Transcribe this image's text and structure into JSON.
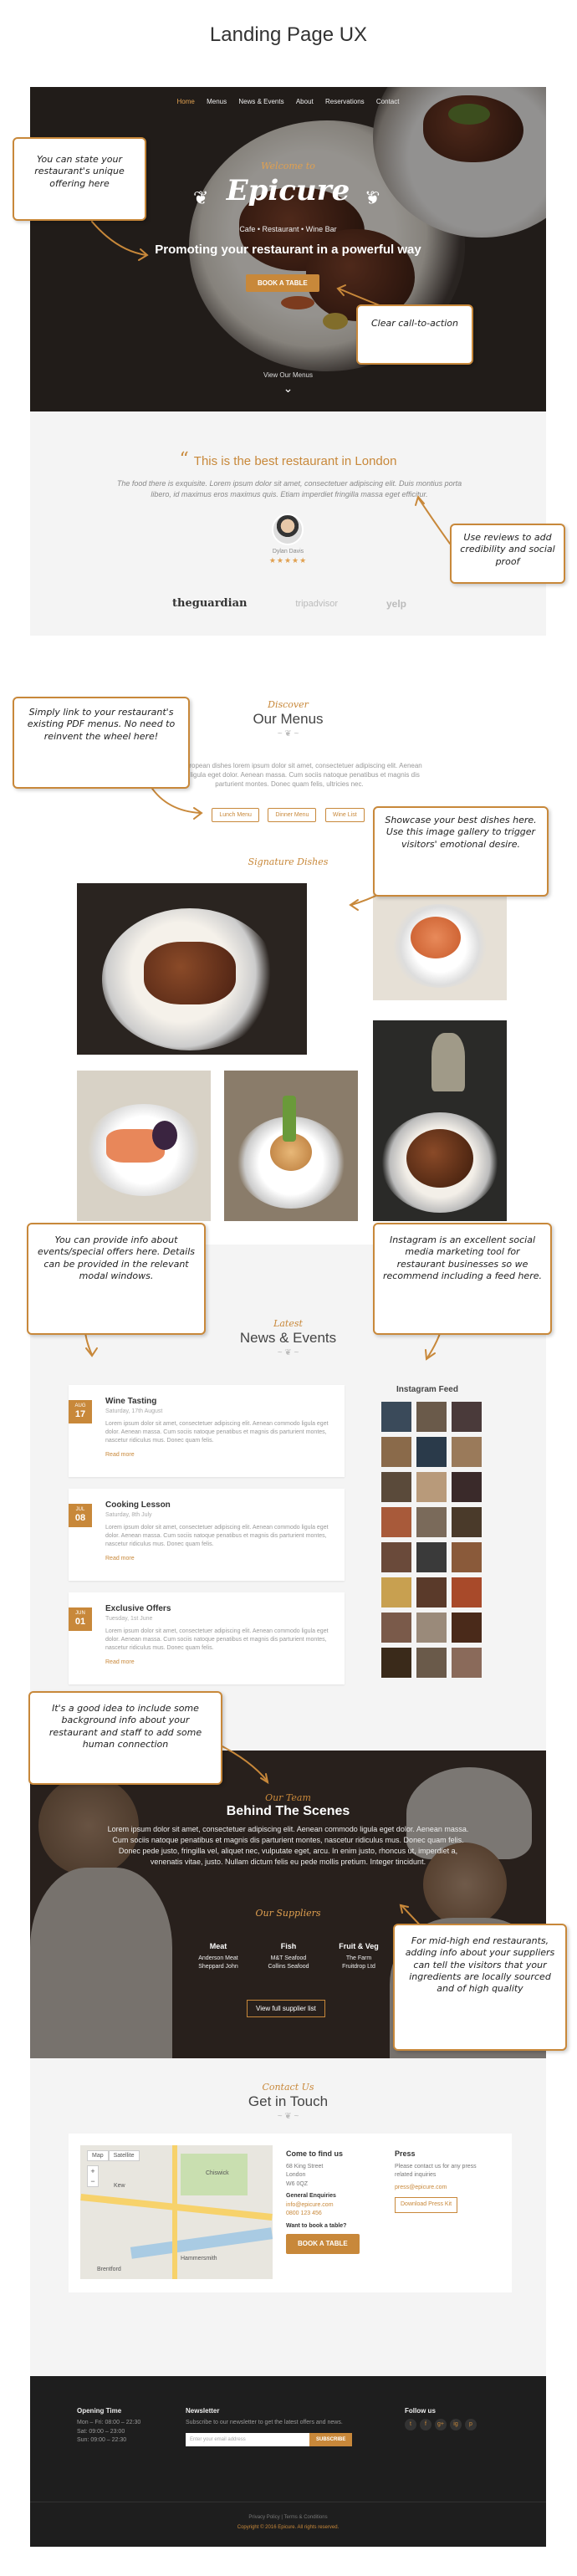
{
  "doc_title": "Landing Page UX",
  "nav": [
    "Home",
    "Menus",
    "News & Events",
    "About",
    "Reservations",
    "Contact"
  ],
  "hero": {
    "welcome": "Welcome to",
    "brand": "Epicure",
    "subtitle": "Cafe • Restaurant • Wine Bar",
    "tagline": "Promoting your restaurant in a powerful way",
    "cta": "BOOK A TABLE",
    "view_menus": "View Our Menus"
  },
  "review": {
    "heading": "This is the best restaurant in London",
    "quote": "The food there is exquisite. Lorem ipsum dolor sit amet, consectetuer adipiscing elit. Duis montius porta libero, id maximus eros maximus quis. Etiam imperdiet fringilla massa eget efficitur.",
    "reviewer": "Dylan Davis",
    "stars": "★★★★★",
    "logos": [
      "theguardian",
      "tripadvisor",
      "yelp"
    ]
  },
  "menus": {
    "script": "Discover",
    "title": "Our Menus",
    "text": "Modern European dishes lorem ipsum dolor sit amet, consectetuer adipiscing elit. Aenean commodo ligula eget dolor. Aenean massa. Cum sociis natoque penatibus et magnis dis parturient montes. Donec quam felis, ultricies nec.",
    "buttons": [
      "Lunch Menu",
      "Dinner Menu",
      "Wine List"
    ],
    "signature": "Signature Dishes"
  },
  "news": {
    "script": "Latest",
    "title": "News & Events",
    "items": [
      {
        "month": "AUG",
        "day": "17",
        "title": "Wine Tasting",
        "date": "Saturday, 17th August",
        "text": "Lorem ipsum dolor sit amet, consectetuer adipiscing elit. Aenean commodo ligula eget dolor. Aenean massa. Cum sociis natoque penatibus et magnis dis parturient montes, nascetur ridiculus mus. Donec quam felis.",
        "more": "Read more"
      },
      {
        "month": "JUL",
        "day": "08",
        "title": "Cooking Lesson",
        "date": "Saturday, 8th July",
        "text": "Lorem ipsum dolor sit amet, consectetuer adipiscing elit. Aenean commodo ligula eget dolor. Aenean massa. Cum sociis natoque penatibus et magnis dis parturient montes, nascetur ridiculus mus. Donec quam felis.",
        "more": "Read more"
      },
      {
        "month": "JUN",
        "day": "01",
        "title": "Exclusive Offers",
        "date": "Tuesday, 1st June",
        "text": "Lorem ipsum dolor sit amet, consectetuer adipiscing elit. Aenean commodo ligula eget dolor. Aenean massa. Cum sociis natoque penatibus et magnis dis parturient montes, nascetur ridiculus mus. Donec quam felis.",
        "more": "Read more"
      }
    ],
    "instagram_title": "Instagram Feed"
  },
  "behind": {
    "script": "Our Team",
    "title": "Behind The Scenes",
    "text": "Lorem ipsum dolor sit amet, consectetuer adipiscing elit. Aenean commodo ligula eget dolor. Aenean massa. Cum sociis natoque penatibus et magnis dis parturient montes, nascetur ridiculus mus. Donec quam felis. Donec pede justo, fringilla vel, aliquet nec, vulputate eget, arcu. In enim justo, rhoncus ut, imperdiet a, venenatis vitae, justo. Nullam dictum felis eu pede mollis pretium. Integer tincidunt.",
    "suppliers_head": "Our Suppliers",
    "suppliers": [
      {
        "name": "Meat",
        "lines": [
          "Anderson Meat",
          "Sheppard John"
        ]
      },
      {
        "name": "Fish",
        "lines": [
          "M&T Seafood",
          "Collins Seafood"
        ]
      },
      {
        "name": "Fruit & Veg",
        "lines": [
          "The Farm",
          "Fruitdrop Ltd"
        ]
      }
    ],
    "supplier_btn": "View full supplier list"
  },
  "contact": {
    "script": "Contact Us",
    "title": "Get in Touch",
    "map_tabs": [
      "Map",
      "Satellite"
    ],
    "map_labels": [
      "Hammersmith",
      "Chiswick",
      "Brentford",
      "Kew"
    ],
    "find_title": "Come to find us",
    "address": [
      "68 King Street",
      "London",
      "W6 0QZ"
    ],
    "enq_title": "General Enquiries",
    "email": "info@epicure.com",
    "phone": "0800 123 456",
    "book_q": "Want to book a table?",
    "book_btn": "BOOK A TABLE",
    "press_title": "Press",
    "press_text": "Please contact us for any press related inquiries",
    "press_email": "press@epicure.com",
    "press_btn": "Download Press Kit"
  },
  "footer": {
    "hours_title": "Opening Time",
    "hours": [
      "Mon – Fri: 08:00 – 22:30",
      "Sat: 09:00 – 23:00",
      "Sun: 09:00 – 22:30"
    ],
    "news_title": "Newsletter",
    "news_text": "Subscribe to our newsletter to get the latest offers and news.",
    "news_placeholder": "Enter your email address",
    "news_btn": "SUBSCRIBE",
    "follow_title": "Follow us",
    "social": [
      "t",
      "f",
      "g+",
      "ig",
      "p"
    ],
    "links": "Privacy Policy  |  Terms & Conditions",
    "copyright": "Copyright © 2016 Epicure. All rights reserved."
  },
  "callouts": {
    "unique": "You can state your restaurant's unique offering here",
    "cta": "Clear call-to-action",
    "reviews": "Use reviews to add credibility and social proof",
    "pdf": "Simply link to your restaurant's existing PDF menus. No need to reinvent the wheel here!",
    "showcase": "Showcase your best dishes here. Use this image gallery to trigger visitors' emotional desire.",
    "events": "You can provide info about events/special offers here. Details can be provided in the relevant modal windows.",
    "instagram": "Instagram is an excellent social media marketing tool for restaurant businesses so we recommend including a feed here.",
    "background": "It's a good idea to include some background info about your restaurant and staff to add some human connection",
    "suppliers": "For mid-high end restaurants, adding info about your suppliers can tell the visitors that your ingredients are locally sourced and of high quality"
  },
  "colors": {
    "accent": "#c8883a",
    "dark": "#1e1e1e",
    "light_bg": "#f4f4f4"
  }
}
